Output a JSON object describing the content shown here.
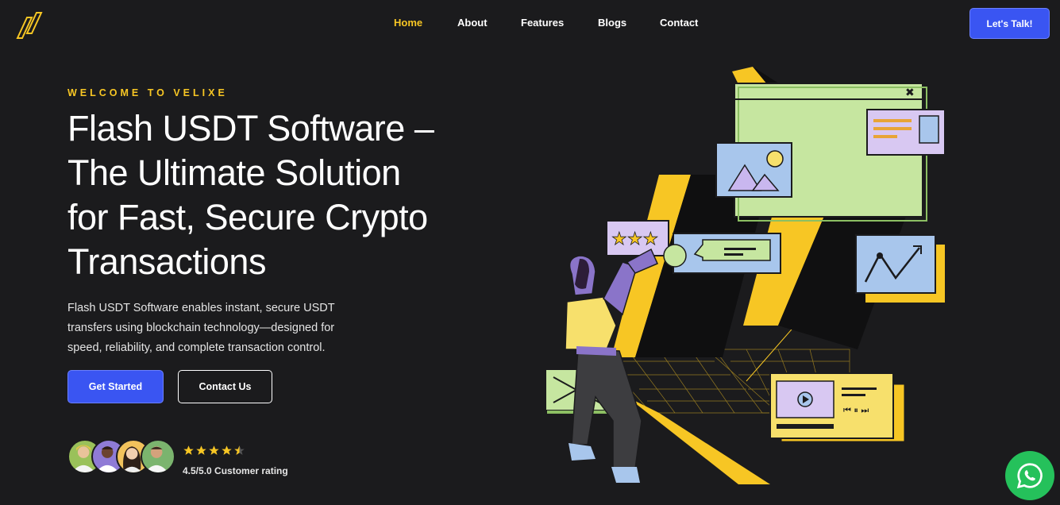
{
  "brand": {
    "logo_icon": "velixe-logo-icon"
  },
  "nav": {
    "items": [
      {
        "label": "Home",
        "active": true
      },
      {
        "label": "About",
        "active": false
      },
      {
        "label": "Features",
        "active": false
      },
      {
        "label": "Blogs",
        "active": false
      },
      {
        "label": "Contact",
        "active": false
      }
    ],
    "cta_label": "Let's Talk!"
  },
  "hero": {
    "eyebrow": "WELCOME TO VELIXE",
    "title_lines": [
      "Flash USDT Software –",
      "The Ultimate Solution",
      "for Fast, Secure Crypto",
      "Transactions"
    ],
    "description": "Flash USDT Software enables instant, secure USDT transfers using blockchain technology—designed for speed, reliability, and complete transaction control.",
    "primary_button": "Get Started",
    "secondary_button": "Contact Us"
  },
  "social_proof": {
    "rating": 4.5,
    "rating_max": 5,
    "rating_text": "4.5/5.0 Customer rating",
    "avatar_count": 4
  },
  "colors": {
    "background": "#1b1b1d",
    "accent_yellow": "#f7c624",
    "accent_blue": "#3a55f2",
    "whatsapp_green": "#25c15b"
  },
  "floating": {
    "icon": "whatsapp-icon"
  }
}
